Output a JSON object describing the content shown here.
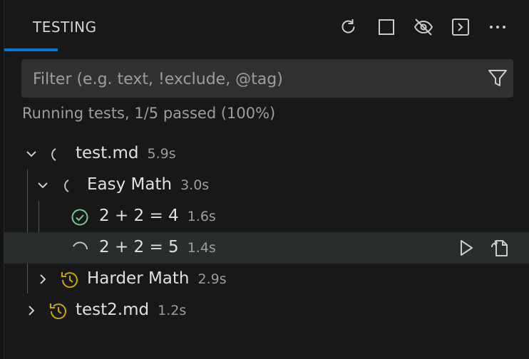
{
  "header": {
    "title": "TESTING",
    "icons": [
      "refresh-icon",
      "stop-icon",
      "eye-hidden-icon",
      "terminal-icon",
      "more-icon"
    ]
  },
  "filter": {
    "placeholder": "Filter (e.g. text, !exclude, @tag)",
    "value": ""
  },
  "status_text": "Running tests, 1/5 passed (100%)",
  "tree": {
    "test_md": {
      "name": "test.md",
      "duration": "5.9s",
      "state": "running"
    },
    "easy_math": {
      "name": "Easy Math",
      "duration": "3.0s",
      "state": "running"
    },
    "t1": {
      "name": "2 + 2 = 4",
      "duration": "1.6s",
      "state": "passed"
    },
    "t2": {
      "name": "2 + 2 = 5",
      "duration": "1.4s",
      "state": "running"
    },
    "harder_math": {
      "name": "Harder Math",
      "duration": "2.9s",
      "state": "queued"
    },
    "test2_md": {
      "name": "test2.md",
      "duration": "1.2s",
      "state": "queued"
    }
  },
  "colors": {
    "accent": "#0078d4",
    "passed": "#73c991",
    "queued": "#cca700",
    "running": "#c5c5c5"
  }
}
